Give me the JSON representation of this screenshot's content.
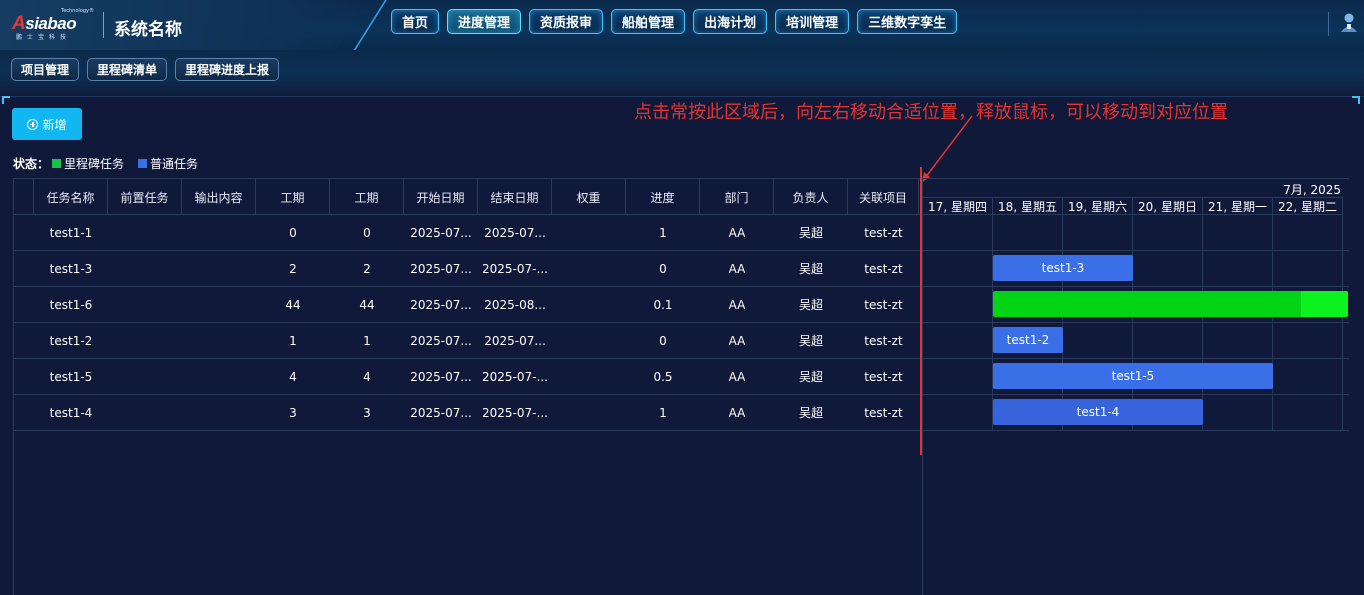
{
  "header": {
    "logo": {
      "brand": "siabao",
      "brand_initial": "A",
      "tech": "Technology®",
      "cn": "鹏士宝科技"
    },
    "system_name": "系统名称",
    "nav": [
      {
        "label": "首页",
        "active": false
      },
      {
        "label": "进度管理",
        "active": true
      },
      {
        "label": "资质报审",
        "active": false
      },
      {
        "label": "船舶管理",
        "active": false
      },
      {
        "label": "出海计划",
        "active": false
      },
      {
        "label": "培训管理",
        "active": false
      },
      {
        "label": "三维数字孪生",
        "active": false
      }
    ],
    "user_icon": "user-avatar-icon"
  },
  "subnav": [
    "项目管理",
    "里程碑清单",
    "里程碑进度上报"
  ],
  "toolbar": {
    "add_label": "新增",
    "add_icon": "plus-circle-icon"
  },
  "annotation": "点击常按此区域后，向左右移动合适位置，释放鼠标，可以移动到对应位置",
  "legend": {
    "label": "状态：",
    "items": [
      {
        "label": "里程碑任务",
        "color": "#19c04a"
      },
      {
        "label": "普通任务",
        "color": "#3b6fe8"
      }
    ]
  },
  "grid": {
    "columns": [
      "任务名称",
      "前置任务",
      "输出内容",
      "工期",
      "工期",
      "开始日期",
      "结束日期",
      "权重",
      "进度",
      "部门",
      "负责人",
      "关联项目"
    ],
    "rows": [
      [
        "test1-1",
        "",
        "",
        "0",
        "0",
        "2025-07...",
        "2025-07...",
        "",
        "1",
        "AA",
        "吴超",
        "test-zt"
      ],
      [
        "test1-3",
        "",
        "",
        "2",
        "2",
        "2025-07...",
        "2025-07-...",
        "",
        "0",
        "AA",
        "吴超",
        "test-zt"
      ],
      [
        "test1-6",
        "",
        "",
        "44",
        "44",
        "2025-07...",
        "2025-08...",
        "",
        "0.1",
        "AA",
        "吴超",
        "test-zt"
      ],
      [
        "test1-2",
        "",
        "",
        "1",
        "1",
        "2025-07...",
        "2025-07...",
        "",
        "0",
        "AA",
        "吴超",
        "test-zt"
      ],
      [
        "test1-5",
        "",
        "",
        "4",
        "4",
        "2025-07...",
        "2025-07-...",
        "",
        "0.5",
        "AA",
        "吴超",
        "test-zt"
      ],
      [
        "test1-4",
        "",
        "",
        "3",
        "3",
        "2025-07...",
        "2025-07-...",
        "",
        "1",
        "AA",
        "吴超",
        "test-zt"
      ]
    ]
  },
  "gantt": {
    "month": "7月, 2025",
    "days": [
      "17, 星期四",
      "18, 星期五",
      "19, 星期六",
      "20, 星期日",
      "21, 星期一",
      "22, 星期二"
    ],
    "bars": [
      {
        "row": 1,
        "label": "test1-3",
        "start_day": 1,
        "days": 2,
        "progress": 0,
        "color": "#3b6fe8",
        "progress_color": "#3b6fe8"
      },
      {
        "row": 2,
        "label": "",
        "start_day": 1,
        "days": 44,
        "progress": 0.1,
        "color": "#00d414",
        "progress_color": "#0bf21e"
      },
      {
        "row": 3,
        "label": "test1-2",
        "start_day": 1,
        "days": 1,
        "progress": 0,
        "color": "#3b6fe8",
        "progress_color": "#3b6fe8"
      },
      {
        "row": 4,
        "label": "test1-5",
        "start_day": 1,
        "days": 4,
        "progress": 0.5,
        "color": "#3b6fe8",
        "progress_color": "#3b6fe8"
      },
      {
        "row": 5,
        "label": "test1-4",
        "start_day": 1,
        "days": 3,
        "progress": 1,
        "color": "#3764dc",
        "progress_color": "#3764dc"
      }
    ]
  }
}
